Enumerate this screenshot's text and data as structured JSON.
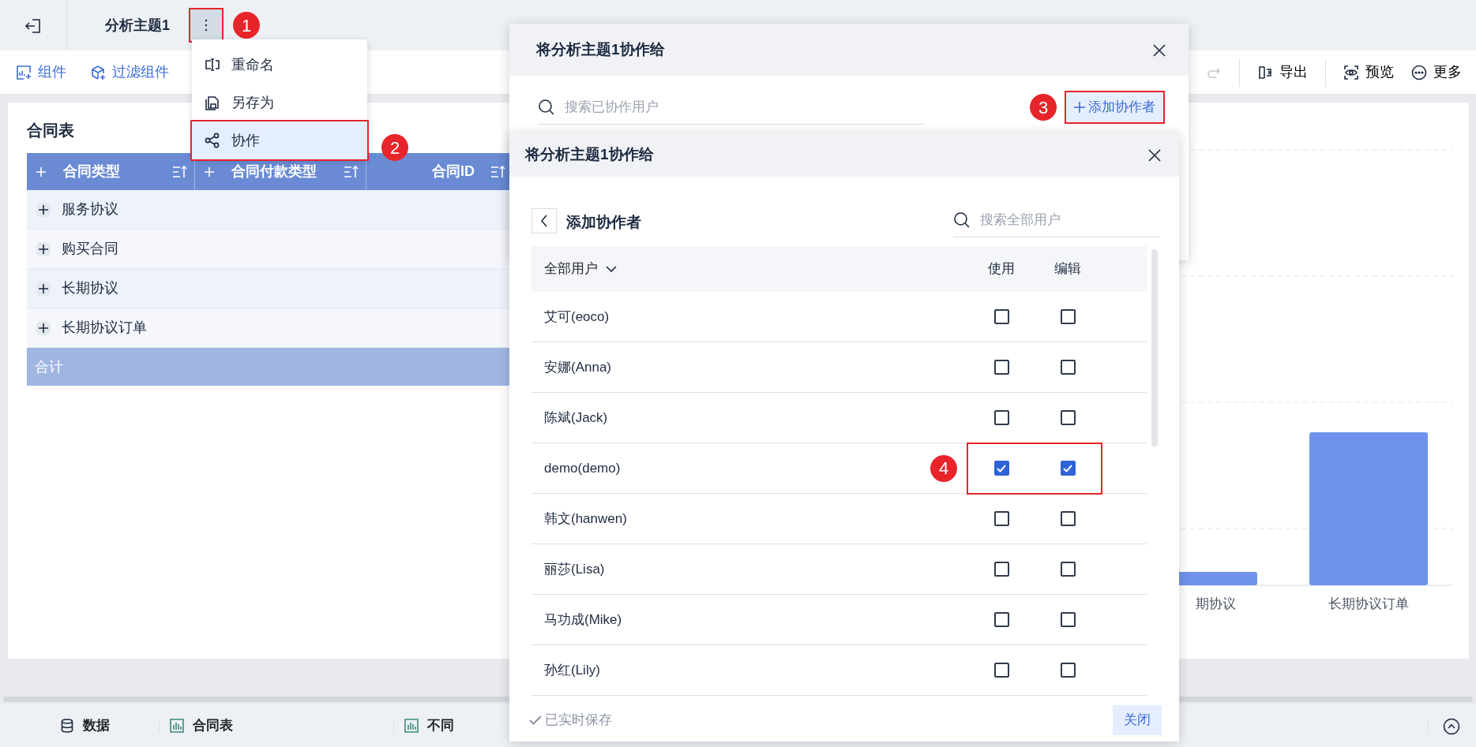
{
  "topbar": {
    "title": "分析主题1",
    "menu_button": {
      "highlighted": true,
      "annotation": "1"
    }
  },
  "menu": {
    "items": [
      {
        "label": "重命名",
        "selected": false,
        "highlighted": false
      },
      {
        "label": "另存为",
        "selected": false,
        "highlighted": false
      },
      {
        "label": "协作",
        "selected": true,
        "highlighted": true,
        "annotation": "2"
      }
    ]
  },
  "toolbar": {
    "left": [
      {
        "label": "组件"
      },
      {
        "label": "过滤组件"
      }
    ],
    "right": [
      {
        "label": "导出"
      },
      {
        "label": "预览"
      },
      {
        "label": "更多"
      }
    ]
  },
  "table": {
    "title": "合同表",
    "columns": [
      {
        "label": "合同类型",
        "expandable": true
      },
      {
        "label": "合同付款类型",
        "expandable": true
      },
      {
        "label": "合同ID",
        "expandable": false
      }
    ],
    "rows": [
      {
        "label": "服务协议"
      },
      {
        "label": "购买合同"
      },
      {
        "label": "长期协议"
      },
      {
        "label": "长期协议订单"
      }
    ],
    "total": "合计"
  },
  "chart": {
    "labels": [
      "期协议",
      "长期协议订单"
    ]
  },
  "share_dialog": {
    "title": "将分析主题1协作给",
    "search": {
      "placeholder": "搜索已协作用户"
    },
    "add_button": {
      "label": "添加协作者",
      "highlighted": true,
      "annotation": "3"
    }
  },
  "add_dialog": {
    "title": "将分析主题1协作给",
    "heading": "添加协作者",
    "search": {
      "placeholder": "搜索全部用户"
    },
    "columns": [
      "全部用户",
      "使用",
      "编辑"
    ],
    "users": [
      {
        "name": "艾可(eoco)",
        "use": false,
        "edit": false,
        "highlighted": false
      },
      {
        "name": "安娜(Anna)",
        "use": false,
        "edit": false,
        "highlighted": false
      },
      {
        "name": "陈斌(Jack)",
        "use": false,
        "edit": false,
        "highlighted": false
      },
      {
        "name": "demo(demo)",
        "use": true,
        "edit": true,
        "highlighted": true,
        "annotation": "4"
      },
      {
        "name": "韩文(hanwen)",
        "use": false,
        "edit": false,
        "highlighted": false
      },
      {
        "name": "丽莎(Lisa)",
        "use": false,
        "edit": false,
        "highlighted": false
      },
      {
        "name": "马功成(Mike)",
        "use": false,
        "edit": false,
        "highlighted": false
      },
      {
        "name": "孙红(Lily)",
        "use": false,
        "edit": false,
        "highlighted": false
      }
    ],
    "status": "已实时保存",
    "close_button": "关闭"
  },
  "bottom_tabs": [
    {
      "label": "数据"
    },
    {
      "label": "合同表"
    },
    {
      "label": "不同"
    }
  ]
}
